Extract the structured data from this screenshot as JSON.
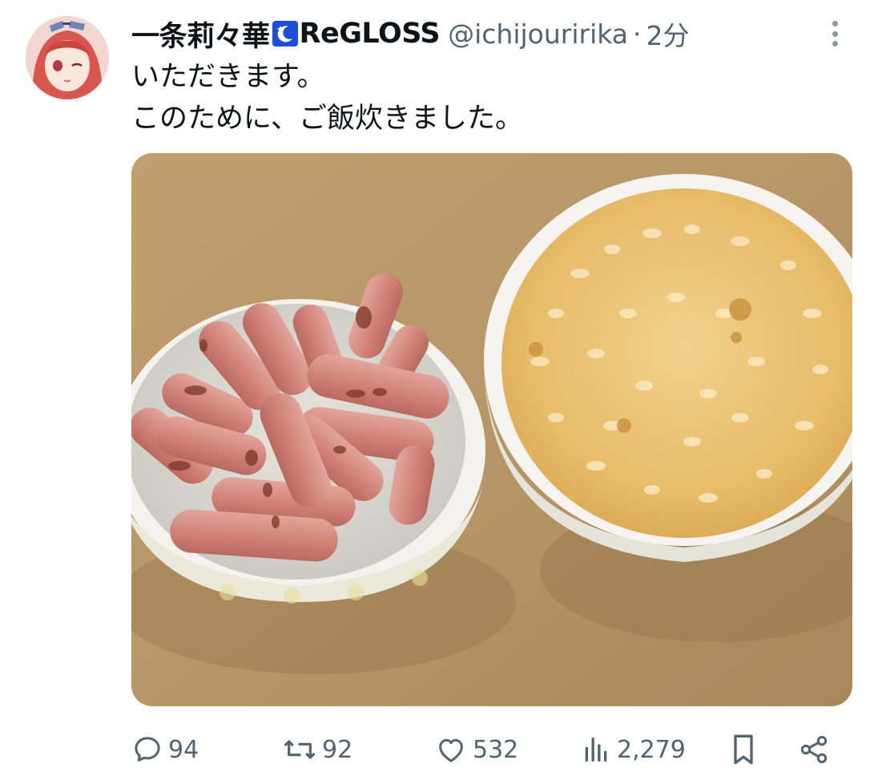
{
  "post": {
    "display_name": "一条莉々華",
    "display_name_suffix": "ReGLOSS",
    "handle": "@ichijouririka",
    "separator": "·",
    "time": "2分",
    "text": "いただきます。\nこのために、ご飯炊きました。"
  },
  "actions": {
    "replies": "94",
    "reposts": "92",
    "likes": "532",
    "views": "2,279"
  },
  "icons": {
    "badge": "crescent-moon-star-icon",
    "more": "more-vertical-icon",
    "reply": "comment-icon",
    "repost": "repost-icon",
    "like": "heart-icon",
    "views": "bar-chart-icon",
    "bookmark": "bookmark-icon",
    "share": "share-icon"
  },
  "colors": {
    "text": "#0f1419",
    "secondary": "#536471",
    "badge": "#1d4fd6"
  }
}
